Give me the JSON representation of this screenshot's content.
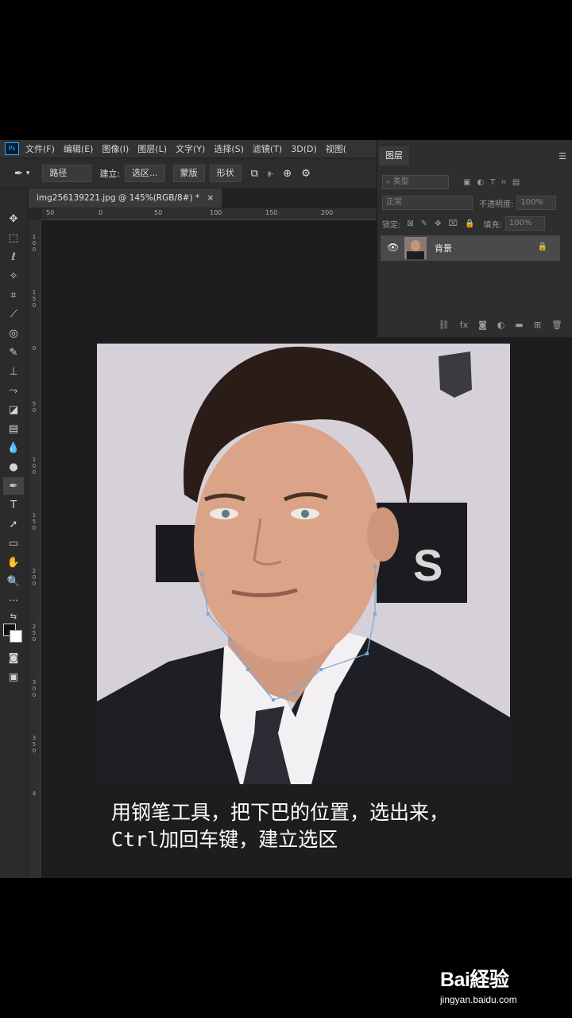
{
  "menu": {
    "logo": "Ps",
    "items": [
      "文件(F)",
      "编辑(E)",
      "图像(I)",
      "图层(L)",
      "文字(Y)",
      "选择(S)",
      "滤镜(T)",
      "3D(D)",
      "视图("
    ]
  },
  "options": {
    "path_mode": "路径",
    "make_label": "建立:",
    "selection_btn": "选区...",
    "mask_btn": "蒙版",
    "shape_btn": "形状"
  },
  "document": {
    "tab_title": "img256139221.jpg @ 145%(RGB/8#) *",
    "ruler_top": [
      "50",
      "0",
      "50",
      "100",
      "150",
      "200"
    ],
    "ruler_left": [
      "1",
      "0",
      "0",
      "1",
      "5",
      "0",
      "0",
      "5",
      "0",
      "1",
      "0",
      "0",
      "1",
      "5",
      "0",
      "2",
      "0",
      "0",
      "2",
      "5",
      "0",
      "3",
      "0",
      "0",
      "3",
      "5",
      "0",
      "4"
    ]
  },
  "layers_panel": {
    "title": "图层",
    "filter_type": "类型",
    "blend_mode": "正常",
    "opacity_label": "不透明度:",
    "opacity_value": "100%",
    "lock_label": "锁定:",
    "fill_label": "填充:",
    "fill_value": "100%",
    "layer_name": "背景",
    "footer_icons": [
      "link-icon",
      "fx-icon",
      "mask-icon",
      "adjustment-icon",
      "folder-icon",
      "new-layer-icon",
      "trash-icon"
    ]
  },
  "caption": {
    "line1": "用钢笔工具，把下巴的位置，选出来，",
    "line2": "Ctrl加回车键，建立选区"
  },
  "watermark": {
    "logo": "Bai経验",
    "url": "jingyan.baidu.com"
  }
}
